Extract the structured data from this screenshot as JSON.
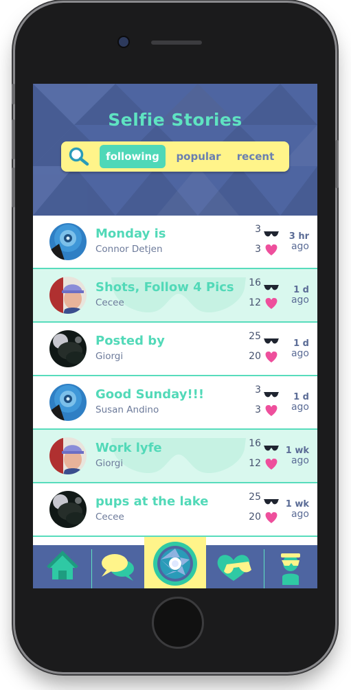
{
  "app": {
    "title": "Selfie Stories"
  },
  "tabs": [
    {
      "label": "following",
      "active": true
    },
    {
      "label": "popular",
      "active": false
    },
    {
      "label": "recent",
      "active": false
    }
  ],
  "stories": [
    {
      "title": "Monday is",
      "author": "Connor Detjen",
      "glasses": "3",
      "hearts": "3",
      "time_value": "3 hr",
      "time_unit": "ago",
      "avatar": "blue-circle"
    },
    {
      "title": "Shots, Follow 4 Pics",
      "author": "Cecee",
      "glasses": "16",
      "hearts": "12",
      "time_value": "1 d",
      "time_unit": "ago",
      "avatar": "person-cap"
    },
    {
      "title": "Posted by",
      "author": "Giorgi",
      "glasses": "25",
      "hearts": "20",
      "time_value": "1 d",
      "time_unit": "ago",
      "avatar": "dark-dog"
    },
    {
      "title": "Good Sunday!!!",
      "author": "Susan Andino",
      "glasses": "3",
      "hearts": "3",
      "time_value": "1 d",
      "time_unit": "ago",
      "avatar": "blue-circle"
    },
    {
      "title": "Work lyfe",
      "author": "Giorgi",
      "glasses": "16",
      "hearts": "12",
      "time_value": "1 wk",
      "time_unit": "ago",
      "avatar": "person-cap"
    },
    {
      "title": "pups at the lake",
      "author": "Cecee",
      "glasses": "25",
      "hearts": "20",
      "time_value": "1 wk",
      "time_unit": "ago",
      "avatar": "dark-dog"
    }
  ],
  "nav": [
    {
      "icon": "home-icon"
    },
    {
      "icon": "chat-icon"
    },
    {
      "icon": "camera-shutter-icon"
    },
    {
      "icon": "heart-glasses-icon"
    },
    {
      "icon": "profile-icon"
    }
  ],
  "colors": {
    "accent": "#5fe3c2",
    "header": "#4e65a1",
    "tabbar": "#fff48a",
    "heart": "#ee4f9c",
    "row_alt": "#d9f8ee"
  }
}
